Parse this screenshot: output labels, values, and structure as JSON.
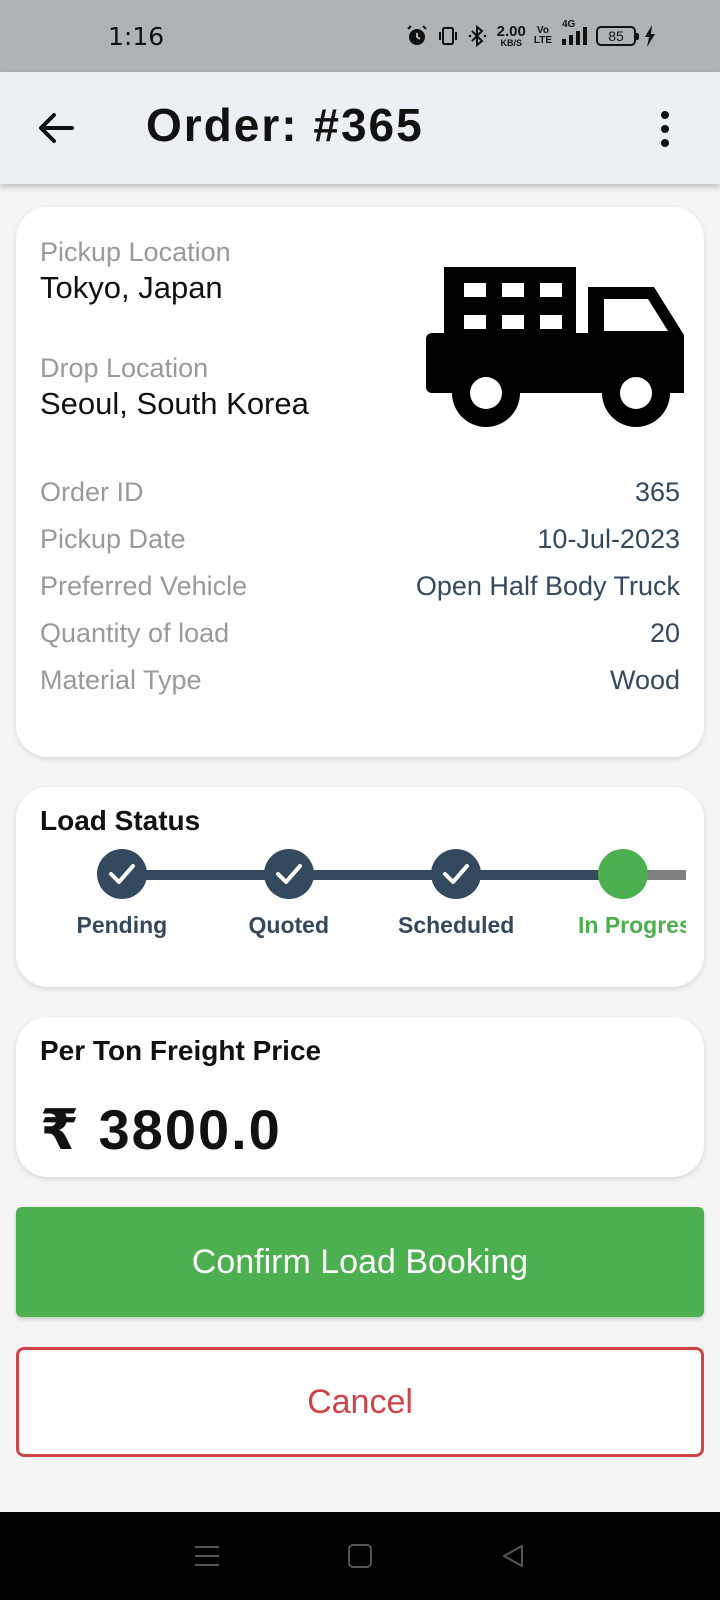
{
  "status_bar": {
    "time": "1:16",
    "net_speed_value": "2.00",
    "net_speed_unit": "KB/S",
    "volte_top": "Vo",
    "volte_bottom": "LTE",
    "network": "4G",
    "battery": "85"
  },
  "app_bar": {
    "title": "Order: #365",
    "back_icon": "arrow-left-icon",
    "menu_icon": "more-vert-icon"
  },
  "order": {
    "pickup_label": "Pickup Location",
    "pickup_value": "Tokyo, Japan",
    "drop_label": "Drop Location",
    "drop_value": "Seoul, South Korea",
    "vehicle_icon": "truck-icon",
    "details": [
      {
        "label": "Order ID",
        "value": "365"
      },
      {
        "label": "Pickup Date",
        "value": "10-Jul-2023"
      },
      {
        "label": "Preferred Vehicle",
        "value": "Open Half Body Truck"
      },
      {
        "label": "Quantity of load",
        "value": "20"
      },
      {
        "label": "Material Type",
        "value": "Wood"
      }
    ]
  },
  "load_status": {
    "title": "Load Status",
    "steps": [
      {
        "label": "Pending",
        "state": "done"
      },
      {
        "label": "Quoted",
        "state": "done"
      },
      {
        "label": "Scheduled",
        "state": "done"
      },
      {
        "label": "In Progres",
        "state": "current"
      }
    ],
    "colors": {
      "done": "#34495e",
      "current": "#4caf50",
      "upcoming": "#808080"
    }
  },
  "price": {
    "title": "Per Ton Freight Price",
    "value": "₹ 3800.0"
  },
  "actions": {
    "confirm_label": "Confirm Load Booking",
    "cancel_label": "Cancel",
    "confirm_color": "#4caf50",
    "cancel_color": "#d04448"
  }
}
